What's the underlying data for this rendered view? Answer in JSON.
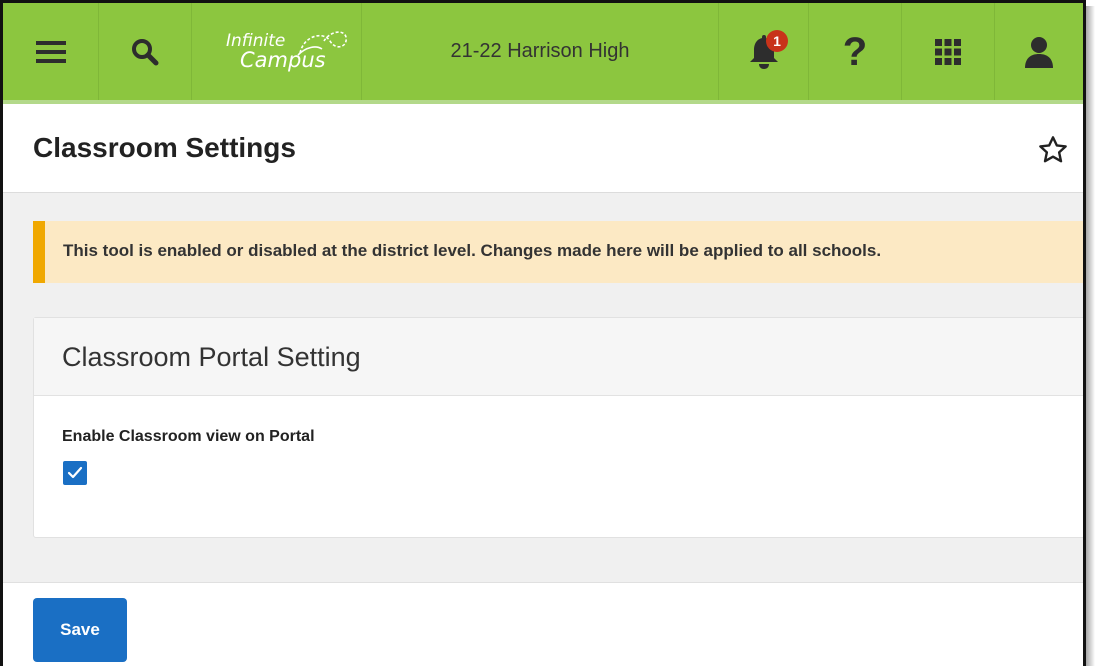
{
  "header": {
    "logo_line1": "Infinite",
    "logo_line2": "Campus",
    "school_label": "21-22 Harrison High",
    "notification_count": "1",
    "help_glyph": "?",
    "brand_color": "#8cc63f"
  },
  "page": {
    "title": "Classroom Settings"
  },
  "alert": {
    "message": "This tool is enabled or disabled at the district level. Changes made here will be applied to all schools.",
    "accent_color": "#f0a800"
  },
  "card": {
    "title": "Classroom Portal Setting",
    "field_label": "Enable Classroom view on Portal",
    "checkbox_checked": true
  },
  "footer": {
    "save_label": "Save",
    "button_color": "#1a6fc4"
  },
  "icons": {
    "menu": "hamburger-menu-icon",
    "search": "search-icon",
    "bell": "bell-icon",
    "help": "help-icon",
    "apps": "app-grid-icon",
    "user": "user-icon",
    "favorite": "star-icon",
    "check": "check-icon"
  }
}
